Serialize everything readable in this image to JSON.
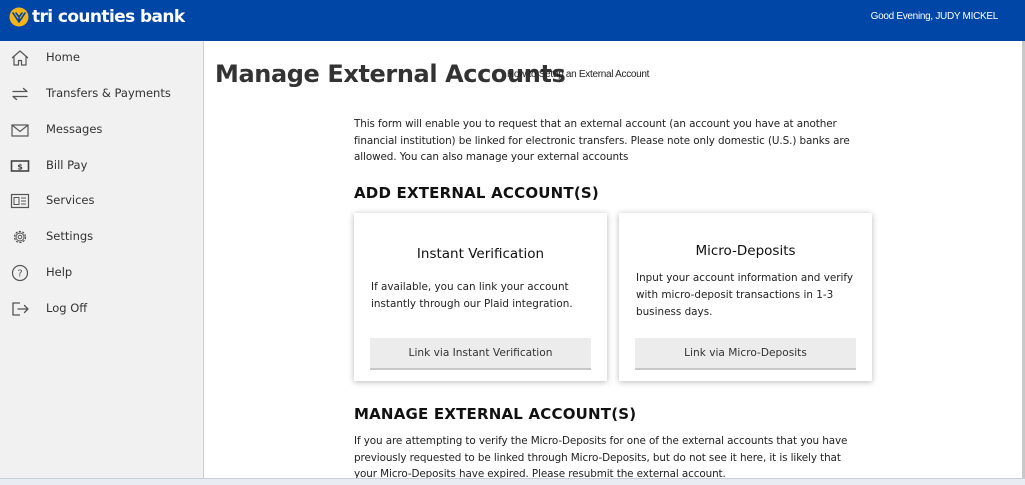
{
  "header": {
    "brand": "tri counties bank",
    "greeting": "Good Evening, JUDY MICKEL",
    "colors": {
      "brand_blue": "#0046a7",
      "logo_gold": "#f3b319"
    }
  },
  "sidebar": {
    "items": [
      {
        "label": "Home",
        "icon": "home-icon"
      },
      {
        "label": "Transfers & Payments",
        "icon": "transfer-arrows-icon"
      },
      {
        "label": "Messages",
        "icon": "envelope-icon"
      },
      {
        "label": "Bill Pay",
        "icon": "dollar-bill-icon"
      },
      {
        "label": "Services",
        "icon": "services-icon"
      },
      {
        "label": "Settings",
        "icon": "gear-icon"
      },
      {
        "label": "Help",
        "icon": "question-circle-icon"
      },
      {
        "label": "Log Off",
        "icon": "log-off-icon"
      }
    ]
  },
  "main": {
    "title": "Manage External Accounts",
    "help_link": "How to Setup an External Account",
    "intro": "This form will enable you to request that an external account (an account you have at another financial institution) be linked for electronic transfers. Please note only domestic (U.S.) banks are allowed. You can also manage your external accounts",
    "add_heading": "ADD EXTERNAL ACCOUNT(S)",
    "cards": [
      {
        "title": "Instant Verification",
        "description": "If available, you can link your account instantly through our Plaid integration.",
        "button": "Link via Instant Verification"
      },
      {
        "title": "Micro-Deposits",
        "description": "Input your account information and verify with micro-deposit transactions in 1-3 business days.",
        "button": "Link via Micro-Deposits"
      }
    ],
    "manage_heading": "MANAGE EXTERNAL ACCOUNT(S)",
    "manage_text": "If you are attempting to verify the Micro-Deposits for one of the external accounts that you have previously requested to be linked through Micro-Deposits, but do not see it here, it is likely that your Micro-Deposits have expired. Please resubmit the external account."
  }
}
